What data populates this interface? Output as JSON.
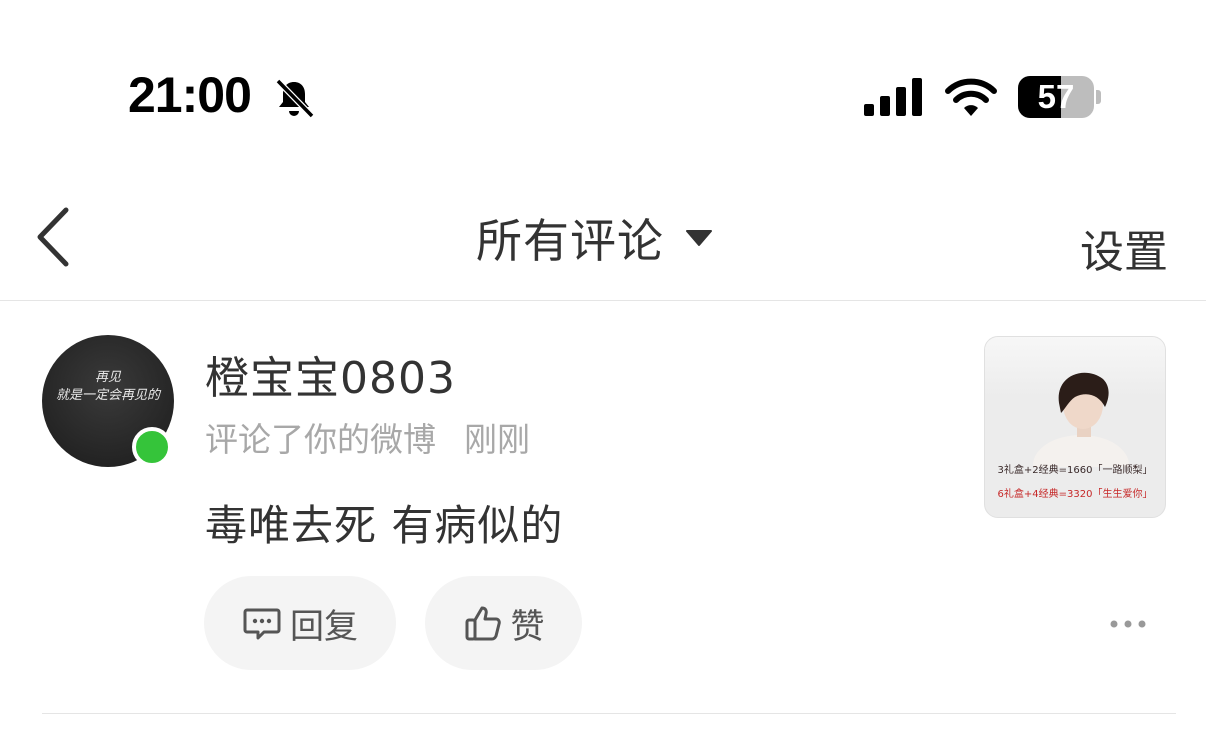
{
  "status_bar": {
    "time": "21:00",
    "battery_level": "57",
    "battery_percent": 57,
    "icons": [
      "bell-muted-icon",
      "cellular-signal-icon",
      "wifi-icon",
      "battery-icon"
    ]
  },
  "nav": {
    "title": "所有评论",
    "settings_label": "设置",
    "icons": [
      "back-chevron-icon",
      "caret-down-icon"
    ]
  },
  "comment": {
    "username": "橙宝宝0803",
    "action": "评论了你的微博",
    "time_ago": "刚刚",
    "text": "毒唯去死 有病似的",
    "online": true,
    "online_color": "#35c43a",
    "avatar_text": {
      "line1": "再见",
      "line2": "就是一定会再见的"
    },
    "thumbnail_text": {
      "line1": "3礼盒+2经典=1660「一路顺梨」",
      "line2": "6礼盒+4经典=3320「生生爱你」"
    },
    "reply_label": "回复",
    "like_label": "赞"
  },
  "colors": {
    "text_primary": "#333333",
    "text_secondary": "#a8a8a8",
    "button_bg": "#f4f4f4",
    "divider": "#e5e5e5",
    "thumbnail_red": "#c62828"
  }
}
